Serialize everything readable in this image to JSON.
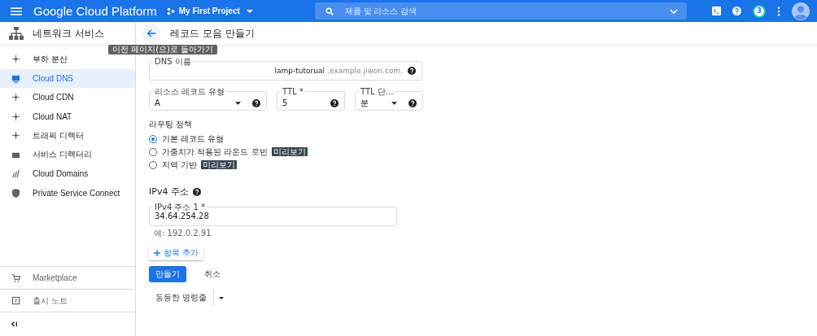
{
  "topbar": {
    "product": "Google Cloud Platform",
    "project": "My First Project",
    "search_placeholder": "제품 및 리소스 검색",
    "notifications": "3"
  },
  "sidebar": {
    "title": "네트워크 서비스",
    "items": [
      {
        "label": "부하 분산",
        "selected": false
      },
      {
        "label": "Cloud DNS",
        "selected": true
      },
      {
        "label": "Cloud CDN",
        "selected": false
      },
      {
        "label": "Cloud NAT",
        "selected": false
      },
      {
        "label": "트래픽 디렉터",
        "selected": false
      },
      {
        "label": "서비스 디렉터리",
        "selected": false
      },
      {
        "label": "Cloud Domains",
        "selected": false
      },
      {
        "label": "Private Service Connect",
        "selected": false
      }
    ],
    "bottom_items": [
      {
        "label": "Marketplace"
      },
      {
        "label": "출시 노트"
      }
    ]
  },
  "page": {
    "title": "레코드 모음 만들기",
    "back_tooltip": "이전 페이지(으)로 돌아가기",
    "dns_name": {
      "label": "DNS 이름",
      "value": "lamp-tutorual",
      "suffix": ".example.jiwon.com."
    },
    "record_type": {
      "label": "리소스 레코드 유형",
      "value": "A"
    },
    "ttl": {
      "label": "TTL *",
      "value": "5"
    },
    "ttl_unit": {
      "label": "TTL 단...",
      "value": "분"
    },
    "routing": {
      "label": "라우팅 정책",
      "options": [
        {
          "label": "기본 레코드 유형",
          "selected": true
        },
        {
          "label": "가중치가 적용된 라운드 로빈",
          "selected": false,
          "badge": "미리보기"
        },
        {
          "label": "지역 기반",
          "selected": false,
          "badge": "미리보기"
        }
      ]
    },
    "ipv4": {
      "heading": "IPv4 주소",
      "field_label": "IPv4 주소 1 *",
      "value": "34.64.254.28",
      "hint": "예: 192.0.2.91"
    },
    "add_item": "항목 추가",
    "create": "만들기",
    "cancel": "취소",
    "equivalent": "동등한 명령줄"
  }
}
